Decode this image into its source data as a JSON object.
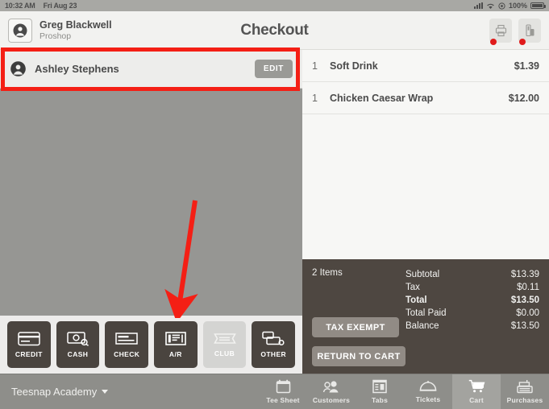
{
  "status_bar": {
    "time": "10:32 AM",
    "date": "Fri Aug 23",
    "battery_percent": "100%",
    "icons": [
      "signal-bars-icon",
      "wifi-icon",
      "location-icon",
      "battery-icon"
    ]
  },
  "header": {
    "user_name": "Greg Blackwell",
    "user_role": "Proshop",
    "title": "Checkout",
    "avatar_icon": "user-avatar-icon",
    "actions": [
      {
        "name": "printer-status-button",
        "icon": "printer-icon",
        "dot_color": "#e01b1b"
      },
      {
        "name": "card-reader-status-button",
        "icon": "card-reader-icon",
        "dot_color": "#e01b1b"
      }
    ]
  },
  "customer_bar": {
    "name": "Ashley Stephens",
    "edit_label": "EDIT",
    "avatar_icon": "customer-avatar-icon"
  },
  "payment_buttons": [
    {
      "label": "CREDIT",
      "icon": "credit-card-icon",
      "disabled": false
    },
    {
      "label": "CASH",
      "icon": "cash-icon",
      "disabled": false
    },
    {
      "label": "CHECK",
      "icon": "check-icon",
      "disabled": false
    },
    {
      "label": "A/R",
      "icon": "ledger-icon",
      "disabled": false
    },
    {
      "label": "CLUB",
      "icon": "ticket-icon",
      "disabled": true
    },
    {
      "label": "OTHER",
      "icon": "other-payment-icon",
      "disabled": false
    }
  ],
  "cart": {
    "items": [
      {
        "qty": "1",
        "name": "Soft Drink",
        "price": "$1.39"
      },
      {
        "qty": "1",
        "name": "Chicken Caesar Wrap",
        "price": "$12.00"
      }
    ],
    "items_count": "2 Items",
    "totals": [
      {
        "label": "Subtotal",
        "value": "$13.39",
        "bold": false
      },
      {
        "label": "Tax",
        "value": "$0.11",
        "bold": false
      },
      {
        "label": "Total",
        "value": "$13.50",
        "bold": true
      },
      {
        "label": "Total Paid",
        "value": "$0.00",
        "bold": false
      },
      {
        "label": "Balance",
        "value": "$13.50",
        "bold": false
      }
    ],
    "tax_exempt_label": "TAX EXEMPT",
    "return_to_cart_label": "RETURN TO CART"
  },
  "bottom_bar": {
    "course": "Teesnap Academy",
    "nav": [
      {
        "label": "Tee Sheet",
        "icon": "calendar-icon",
        "active": false
      },
      {
        "label": "Customers",
        "icon": "people-icon",
        "active": false
      },
      {
        "label": "Tabs",
        "icon": "tabs-grid-icon",
        "active": false
      },
      {
        "label": "Tickets",
        "icon": "food-dome-icon",
        "active": false
      },
      {
        "label": "Cart",
        "icon": "shopping-cart-icon",
        "active": true
      },
      {
        "label": "Purchases",
        "icon": "cash-register-icon",
        "active": false
      }
    ]
  },
  "annotations": {
    "highlight_color": "#f41f15",
    "highlight_target": "customer-bar",
    "arrow_color": "#f41f15",
    "arrow_target": "payment-button-ar"
  }
}
